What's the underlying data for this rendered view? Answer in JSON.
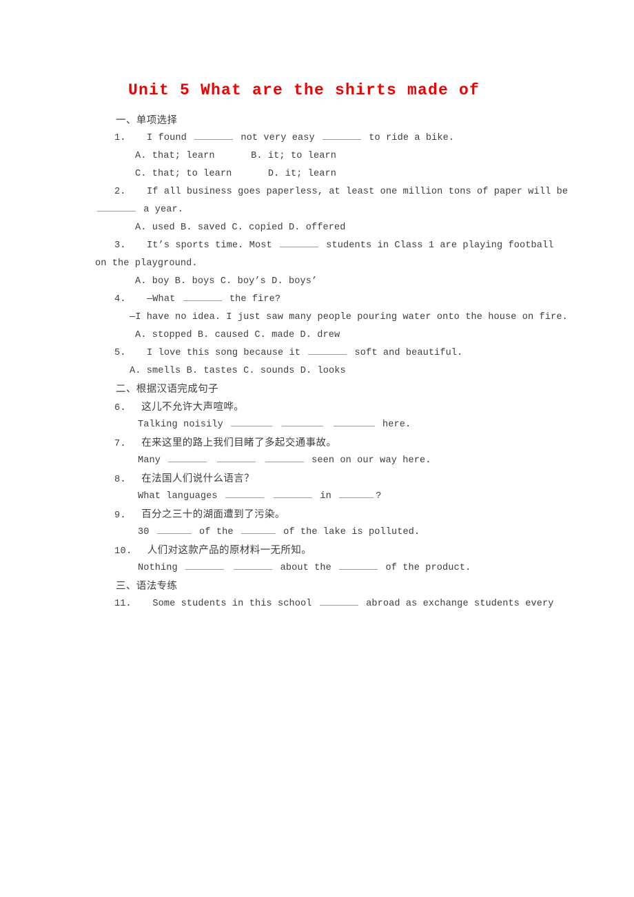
{
  "document": {
    "title": "Unit 5 What are the shirts made of",
    "title_color": "#ef0000"
  },
  "sections": [
    {
      "id": "section-1",
      "heading": "一、单项选择"
    },
    {
      "id": "section-2",
      "heading": "二、根据汉语完成句子"
    },
    {
      "id": "section-3",
      "heading": "三、语法专练"
    }
  ],
  "q1": {
    "number": "1.",
    "stem_a": "I found",
    "stem_b": "not very easy",
    "stem_c": "to ride a bike.",
    "optA": "A. that; learn",
    "optB": "B. it; to learn",
    "optC": "C. that; to learn",
    "optD": "D. it; learn"
  },
  "q2": {
    "number": "2.",
    "stem_a": "If all business goes paperless, at least one million tons of paper will be",
    "stem_b": "a year.",
    "options": "A. used  B. saved  C. copied  D. offered"
  },
  "q3": {
    "number": "3.",
    "stem_a": "It’s sports time. Most",
    "stem_b": "students in Class 1 are playing football",
    "stem_c": "on the playground.",
    "options": "A. boy  B. boys  C. boy’s  D. boys’"
  },
  "q4": {
    "number": "4.",
    "stem_a": "—What",
    "stem_b": "the fire?",
    "reply": "—I have no idea. I just saw many people pouring water onto the house on fire.",
    "options": "A. stopped  B. caused  C. made  D. drew"
  },
  "q5": {
    "number": "5.",
    "stem_a": "I love this song because it",
    "stem_b": "soft and beautiful.",
    "options": "A. smells  B. tastes  C. sounds  D. looks"
  },
  "q6": {
    "number": "6.",
    "chinese": "这儿不允许大声喧哗。",
    "answer_a": "Talking noisily",
    "answer_b": "here."
  },
  "q7": {
    "number": "7.",
    "chinese": "在来这里的路上我们目睹了多起交通事故。",
    "answer_a": "Many",
    "answer_b": "seen on our way here."
  },
  "q8": {
    "number": "8.",
    "chinese": "在法国人们说什么语言？",
    "answer_a": "What languages",
    "answer_b": "in",
    "answer_c": "?"
  },
  "q9": {
    "number": "9.",
    "chinese": "百分之三十的湖面遭到了污染。",
    "answer_a": "30",
    "answer_b": "of the",
    "answer_c": "of the lake is polluted."
  },
  "q10": {
    "number": "10.",
    "chinese": "人们对这款产品的原材料一无所知。",
    "answer_a": "Nothing",
    "answer_b": "about the",
    "answer_c": "of the product."
  },
  "q11": {
    "number": "11.",
    "stem_a": "Some students in this school",
    "stem_b": "abroad as exchange students every"
  }
}
